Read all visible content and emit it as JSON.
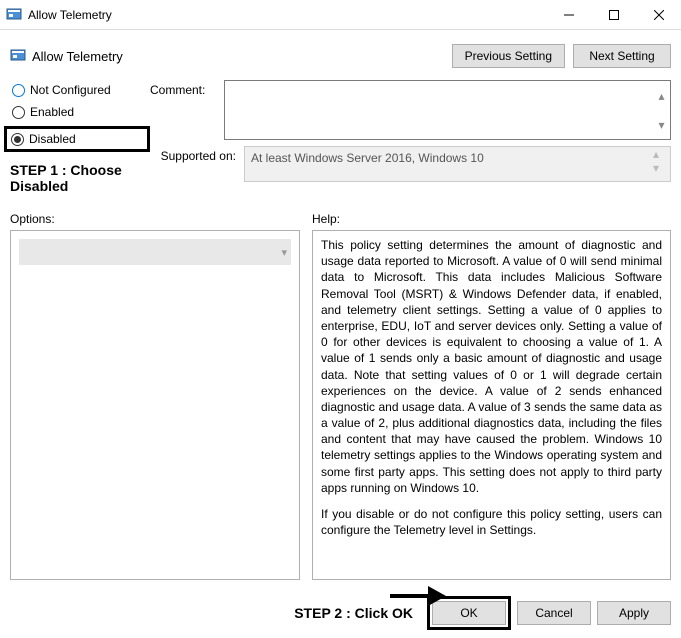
{
  "window": {
    "title": "Allow Telemetry"
  },
  "subtitle": "Allow Telemetry",
  "nav": {
    "prev": "Previous Setting",
    "next": "Next Setting"
  },
  "radios": {
    "not_configured": "Not Configured",
    "enabled": "Enabled",
    "disabled": "Disabled"
  },
  "labels": {
    "comment": "Comment:",
    "supported_on": "Supported on:",
    "options": "Options:",
    "help": "Help:"
  },
  "supported_on_text": "At least Windows Server 2016, Windows 10",
  "annotations": {
    "step1": "STEP 1 : Choose Disabled",
    "step2": "STEP 2 : Click OK"
  },
  "help_text_p1": "This policy setting determines the amount of diagnostic and usage data reported to Microsoft. A value of 0 will send minimal data to Microsoft. This data includes Malicious Software Removal Tool (MSRT) & Windows Defender data, if enabled, and telemetry client settings. Setting a value of 0 applies to enterprise, EDU, IoT and server devices only. Setting a value of 0 for other devices is equivalent to choosing a value of 1. A value of 1 sends only a basic amount of diagnostic and usage data. Note that setting values of 0 or 1 will degrade certain experiences on the device. A value of 2 sends enhanced diagnostic and usage data. A value of 3 sends the same data as a value of 2, plus additional diagnostics data, including the files and content that may have caused the problem. Windows 10 telemetry settings applies to the Windows operating system and some first party apps. This setting does not apply to third party apps running on Windows 10.",
  "help_text_p2": "If you disable or do not configure this policy setting, users can configure the Telemetry level in Settings.",
  "buttons": {
    "ok": "OK",
    "cancel": "Cancel",
    "apply": "Apply"
  }
}
